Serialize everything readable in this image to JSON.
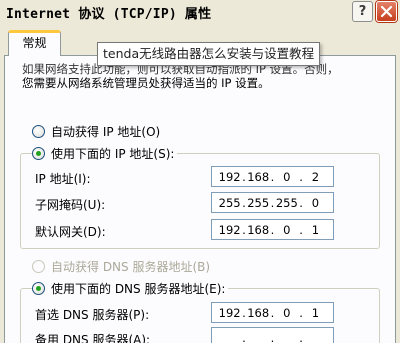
{
  "window": {
    "title": "Internet 协议 (TCP/IP) 属性",
    "help_label": "?",
    "close_icon": "close-icon"
  },
  "tabs": [
    {
      "label": "常规",
      "selected": true
    }
  ],
  "tooltip": {
    "text": "tenda无线路由器怎么安装与设置教程"
  },
  "description": {
    "line1": "如果网络支持此功能，则可以获取自动指派的 IP 设置。否则，",
    "line2": "您需要从网络系统管理员处获得适当的 IP 设置。"
  },
  "ip_section": {
    "auto_option": {
      "label": "自动获得 IP 地址(O)",
      "checked": false
    },
    "manual_option": {
      "label": "使用下面的 IP 地址(S):",
      "checked": true
    },
    "fields": [
      {
        "label": "IP 地址(I):",
        "octets": [
          "192",
          "168",
          "0",
          "2"
        ]
      },
      {
        "label": "子网掩码(U):",
        "octets": [
          "255",
          "255",
          "255",
          "0"
        ]
      },
      {
        "label": "默认网关(D):",
        "octets": [
          "192",
          "168",
          "0",
          "1"
        ]
      }
    ]
  },
  "dns_section": {
    "auto_option": {
      "label": "自动获得 DNS 服务器地址(B)",
      "checked": false,
      "disabled": true
    },
    "manual_option": {
      "label": "使用下面的 DNS 服务器地址(E):",
      "checked": true
    },
    "fields": [
      {
        "label": "首选 DNS 服务器(P):",
        "octets": [
          "192",
          "168",
          "0",
          "1"
        ]
      },
      {
        "label": "备用 DNS 服务器(A):",
        "octets": [
          "",
          "",
          "",
          ""
        ]
      }
    ]
  },
  "colors": {
    "dialog_bg": "#ece9d8",
    "tab_highlight": "#ffc83c",
    "radio_dot": "#21a121",
    "close_button": "#c63e1c"
  }
}
